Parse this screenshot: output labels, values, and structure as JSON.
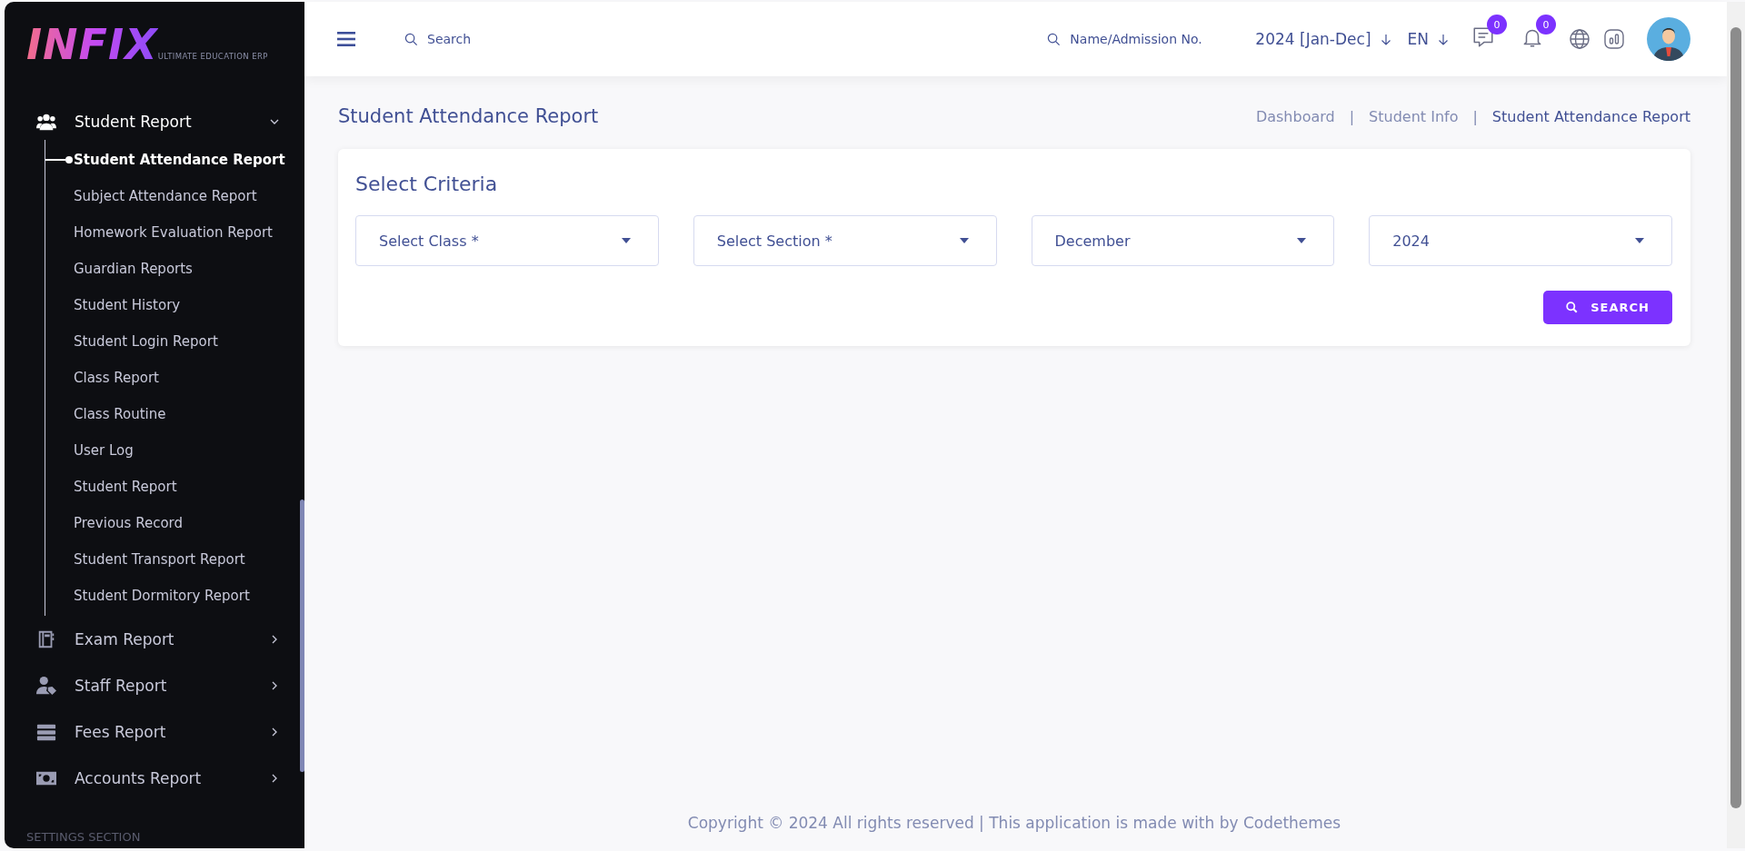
{
  "logo": {
    "name": "INFIX",
    "tagline": "ULTIMATE EDUCATION ERP"
  },
  "sidebar": {
    "groups": [
      {
        "label": "Student Report",
        "expanded": true,
        "children": [
          {
            "label": "Student Attendance Report",
            "selected": true
          },
          {
            "label": "Subject Attendance Report",
            "selected": false
          },
          {
            "label": "Homework Evaluation Report",
            "selected": false
          },
          {
            "label": "Guardian Reports",
            "selected": false
          },
          {
            "label": "Student History",
            "selected": false
          },
          {
            "label": "Student Login Report",
            "selected": false
          },
          {
            "label": "Class Report",
            "selected": false
          },
          {
            "label": "Class Routine",
            "selected": false
          },
          {
            "label": "User Log",
            "selected": false
          },
          {
            "label": "Student Report",
            "selected": false
          },
          {
            "label": "Previous Record",
            "selected": false
          },
          {
            "label": "Student Transport Report",
            "selected": false
          },
          {
            "label": "Student Dormitory Report",
            "selected": false
          }
        ]
      },
      {
        "label": "Exam Report",
        "expanded": false
      },
      {
        "label": "Staff Report",
        "expanded": false
      },
      {
        "label": "Fees Report",
        "expanded": false
      },
      {
        "label": "Accounts Report",
        "expanded": false
      }
    ],
    "section_heading": "SETTINGS SECTION"
  },
  "header": {
    "search": {
      "placeholder": "Search"
    },
    "student_search": {
      "placeholder": "Name/Admission No."
    },
    "session": "2024 [Jan-Dec]",
    "language": "EN",
    "messages_count": "0",
    "notifications_count": "0"
  },
  "page": {
    "title": "Student Attendance Report",
    "breadcrumbs": [
      {
        "kind": "link",
        "text": "Dashboard"
      },
      {
        "kind": "separator",
        "text": "|"
      },
      {
        "kind": "link",
        "text": "Student Info"
      },
      {
        "kind": "separator",
        "text": "|"
      },
      {
        "kind": "current",
        "text": "Student Attendance Report"
      }
    ]
  },
  "criteria": {
    "title": "Select Criteria",
    "selects": [
      {
        "value": "Select Class *"
      },
      {
        "value": "Select Section *"
      },
      {
        "value": "December"
      },
      {
        "value": "2024"
      }
    ],
    "button": "SEARCH"
  },
  "footer": "Copyright © 2024 All rights reserved | This application is made with by Codethemes"
}
